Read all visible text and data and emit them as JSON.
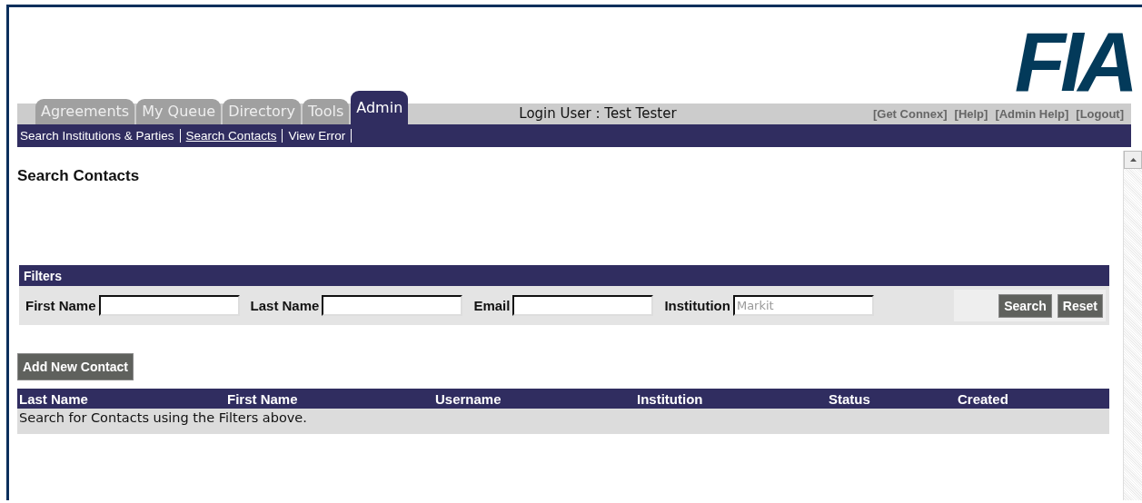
{
  "logo": "FIA",
  "tabs": [
    {
      "label": "Agreements",
      "selected": false
    },
    {
      "label": "My Queue",
      "selected": false
    },
    {
      "label": "Directory",
      "selected": false
    },
    {
      "label": "Tools",
      "selected": false
    },
    {
      "label": "Admin",
      "selected": true
    }
  ],
  "login_user": "Login User : Test Tester",
  "header_links": [
    "[Get Connex]",
    "[Help]",
    "[Admin Help]",
    "[Logout]"
  ],
  "subnav": [
    {
      "label": "Search Institutions & Parties",
      "selected": false
    },
    {
      "label": "Search Contacts",
      "selected": true
    },
    {
      "label": "View Error",
      "selected": false
    }
  ],
  "page_title": "Search Contacts",
  "filters": {
    "title": "Filters",
    "fields": [
      {
        "label": "First Name"
      },
      {
        "label": "Last Name"
      },
      {
        "label": "Email"
      },
      {
        "label": "Institution",
        "placeholder": "Markit"
      }
    ],
    "buttons": [
      "Search",
      "Reset"
    ]
  },
  "add_button": "Add New Contact",
  "table": {
    "columns": [
      "Last Name",
      "First Name",
      "Username",
      "Institution",
      "Status",
      "Created"
    ],
    "empty_message": "Search for Contacts using the Filters above."
  }
}
